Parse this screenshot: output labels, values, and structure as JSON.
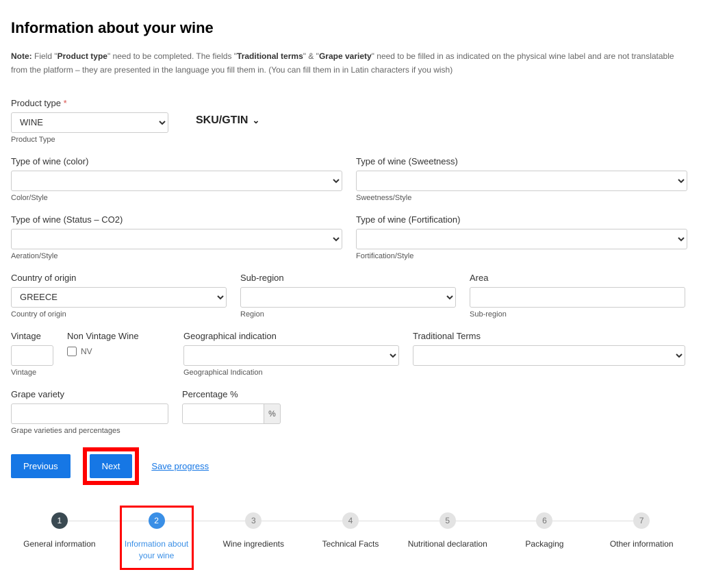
{
  "page": {
    "title": "Information about your wine",
    "note_prefix": "Note:",
    "note_text_1": " Field \"",
    "note_bold_1": "Product type",
    "note_text_2": "\" need to be completed. The fields \"",
    "note_bold_2": "Traditional terms",
    "note_text_3": "\" & \"",
    "note_bold_3": "Grape variety",
    "note_text_4": "\" need to be filled in as indicated on the physical wine label and are not translatable from the platform – they are presented in the language you fill them in. (You can fill them in in Latin characters if you wish)"
  },
  "fields": {
    "product_type": {
      "label": "Product type",
      "value": "WINE",
      "helper": "Product Type"
    },
    "sku": {
      "label": "SKU/GTIN"
    },
    "color": {
      "label": "Type of wine (color)",
      "value": "",
      "helper": "Color/Style"
    },
    "sweetness": {
      "label": "Type of wine (Sweetness)",
      "value": "",
      "helper": "Sweetness/Style"
    },
    "status": {
      "label": "Type of wine (Status – CO2)",
      "value": "",
      "helper": "Aeration/Style"
    },
    "fortification": {
      "label": "Type of wine (Fortification)",
      "value": "",
      "helper": "Fortification/Style"
    },
    "country": {
      "label": "Country of origin",
      "value": "GREECE",
      "helper": "Country of origin"
    },
    "subregion": {
      "label": "Sub-region",
      "value": "",
      "helper": "Region"
    },
    "area": {
      "label": "Area",
      "value": "",
      "helper": "Sub-region"
    },
    "vintage": {
      "label": "Vintage",
      "value": "",
      "helper": "Vintage"
    },
    "nv": {
      "label": "Non Vintage Wine",
      "cb_label": "NV"
    },
    "gi": {
      "label": "Geographical indication",
      "value": "",
      "helper": "Geographical Indication"
    },
    "tt": {
      "label": "Traditional Terms",
      "value": ""
    },
    "grape": {
      "label": "Grape variety",
      "value": "",
      "helper": "Grape varieties and percentages"
    },
    "pct": {
      "label": "Percentage %",
      "value": "",
      "addon": "%"
    }
  },
  "buttons": {
    "previous": "Previous",
    "next": "Next",
    "save": "Save progress"
  },
  "steps": [
    {
      "num": "1",
      "label": "General information"
    },
    {
      "num": "2",
      "label": "Information about your wine"
    },
    {
      "num": "3",
      "label": "Wine ingredients"
    },
    {
      "num": "4",
      "label": "Technical Facts"
    },
    {
      "num": "5",
      "label": "Nutritional declaration"
    },
    {
      "num": "6",
      "label": "Packaging"
    },
    {
      "num": "7",
      "label": "Other information"
    }
  ]
}
